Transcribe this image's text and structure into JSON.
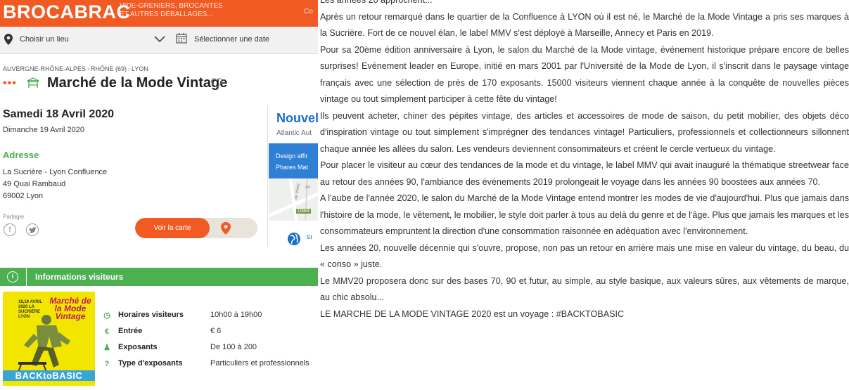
{
  "header": {
    "logo": "BROCABRAC",
    "tagline_line1": "VIDE-GRENIERS, BROCANTES",
    "tagline_line2": "ET AUTRES DÉBALLAGES...",
    "extra": "Co"
  },
  "search": {
    "place_label": "Choisir un lieu",
    "date_label": "Sélectionner une date"
  },
  "breadcrumb": [
    "AUVERGNE-RHÔNE-ALPES",
    "RHÔNE (69)",
    "LYON"
  ],
  "event": {
    "dots": "•••",
    "title": "Marché de la Mode Vintage",
    "date_main": "Samedi 18 Avril 2020",
    "date_second": "Dimanche 19 Avril 2020"
  },
  "address": {
    "label": "Adresse",
    "lines": [
      "La Sucrière - Lyon Confluence",
      "49 Quai Rambaud",
      "69002 Lyon"
    ]
  },
  "share": {
    "label": "Partager",
    "facebook_glyph": "f",
    "twitter_glyph": "t"
  },
  "map_button": "Voir la carte",
  "ad_card": {
    "title": "Nouvel",
    "subtitle": "Atlantic Aut",
    "blue_line1": "Design affir",
    "blue_line2": "Phares Mat",
    "road_label": "D383",
    "street_label": "de Vivier",
    "av_label": "Av",
    "extra": "sı"
  },
  "info_visitors": {
    "icon_glyph": "i",
    "title": "Informations visiteurs",
    "rows": [
      {
        "icon": "clock-icon",
        "glyph": "◷",
        "label": "Horaires visiteurs",
        "value": "10h00 à 19h00"
      },
      {
        "icon": "euro-icon",
        "glyph": "€",
        "label": "Entrée",
        "value": "€ 6"
      },
      {
        "icon": "person-icon",
        "glyph": "♟",
        "label": "Exposants",
        "value": "De 100 à 200"
      },
      {
        "icon": "question-icon",
        "glyph": "?",
        "label": "Type d'exposants",
        "value": "Particuliers et professionnels"
      }
    ]
  },
  "poster": {
    "date_lines": "18,19 AVRIL 2020 LA SUCRIÈRE LYON",
    "title": "Marché de la Mode Vintage",
    "footer": "BACKtoBASIC"
  },
  "article": [
    "Les années 20 approchent...",
    "Après un retour remarqué dans le quartier de la Confluence à LYON où il est né, le Marché de la Mode Vintage a pris ses marques à la Sucrière. Fort de ce nouvel élan, le label MMV s'est déployé à Marseille, Annecy et Paris en 2019.",
    "Pour sa 20ème édition anniversaire à Lyon, le salon du Marché de la Mode vintage, événement historique prépare encore de belles surprises! Evénement leader en Europe, initié en mars 2001 par l'Université de la Mode de Lyon, il s'inscrit dans le paysage vintage français avec une sélection de près de 170 exposants. 15000 visiteurs viennent chaque année à la conquête de nouvelles pièces vintage ou tout simplement participer à cette fête du vintage!",
    "Ils peuvent acheter, chiner des pépites vintage, des articles et accessoires de mode de saison, du petit mobilier, des objets déco d'inspiration vintage ou tout simplement s'imprégner des tendances vintage! Particuliers, professionnels et collectionneurs sillonnent chaque année les allées du salon. Les vendeurs deviennent consommateurs et créent le cercle vertueux du vintage.",
    "Pour placer le visiteur au cœur des tendances de la mode et du vintage, le label MMV qui avait inauguré la thématique streetwear face au retour des années 90, l'ambiance des événements 2019 prolongeait le voyage dans les années 90 boostées aux années 70.",
    "A l'aube de l'année 2020, le salon du Marché de la Mode Vintage entend montrer les modes de vie d'aujourd'hui. Plus que jamais dans l'histoire de la mode, le vêtement, le mobilier, le style doit parler à tous au delà du genre et de l'âge. Plus que jamais les marques et les consommateurs empruntent la direction d'une consommation raisonnée en adéquation avec l'environnement.",
    "Les années 20, nouvelle décennie qui s'ouvre, propose, non pas un retour en arrière mais une mise en valeur du vintage, du beau, du « conso » juste.",
    "Le MMV20 proposera donc sur des bases 70, 90 et futur, au simple, au style basique, aux valeurs sûres, aux vêtements de marque, au chic absolu...",
    "LE MARCHE DE LA MODE VINTAGE 2020 est un voyage : #BACKTOBASIC"
  ],
  "colors": {
    "brand_orange": "#f15a22",
    "info_green": "#4caf50",
    "link_blue": "#1a6fc8",
    "poster_yellow": "#f2e600"
  }
}
